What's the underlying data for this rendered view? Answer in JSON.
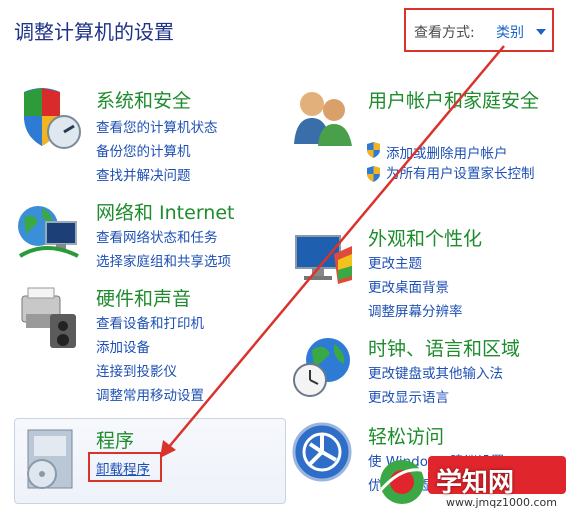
{
  "header": {
    "title": "调整计算机的设置",
    "view_by_label": "查看方式:",
    "view_by_value": "类别"
  },
  "categories": [
    {
      "title": "系统和安全",
      "icon": "system-security-icon",
      "links": [
        "查看您的计算机状态",
        "备份您的计算机",
        "查找并解决问题"
      ]
    },
    {
      "title": "网络和 Internet",
      "icon": "network-internet-icon",
      "links": [
        "查看网络状态和任务",
        "选择家庭组和共享选项"
      ]
    },
    {
      "title": "硬件和声音",
      "icon": "hardware-sound-icon",
      "links": [
        "查看设备和打印机",
        "添加设备",
        "连接到投影仪",
        "调整常用移动设置"
      ]
    },
    {
      "title": "程序",
      "icon": "programs-icon",
      "links": [
        "卸载程序"
      ]
    },
    {
      "title": "用户帐户和家庭安全",
      "icon": "user-accounts-icon",
      "links": [
        "添加或删除用户帐户",
        "为所有用户设置家长控制"
      ]
    },
    {
      "title": "外观和个性化",
      "icon": "appearance-icon",
      "links": [
        "更改主题",
        "更改桌面背景",
        "调整屏幕分辨率"
      ]
    },
    {
      "title": "时钟、语言和区域",
      "icon": "clock-language-region-icon",
      "links": [
        "更改键盘或其他输入法",
        "更改显示语言"
      ]
    },
    {
      "title": "轻松访问",
      "icon": "ease-of-access-icon",
      "links": [
        "使 Windows 建议设置",
        "优化视觉显示"
      ]
    }
  ],
  "watermark": {
    "title": "学知网",
    "url": "www.jmqz1000.com"
  },
  "colors": {
    "category_title": "#1e8c2d",
    "link": "#1e50b4",
    "annotation_red": "#d9332c",
    "page_title": "#1e3287"
  }
}
